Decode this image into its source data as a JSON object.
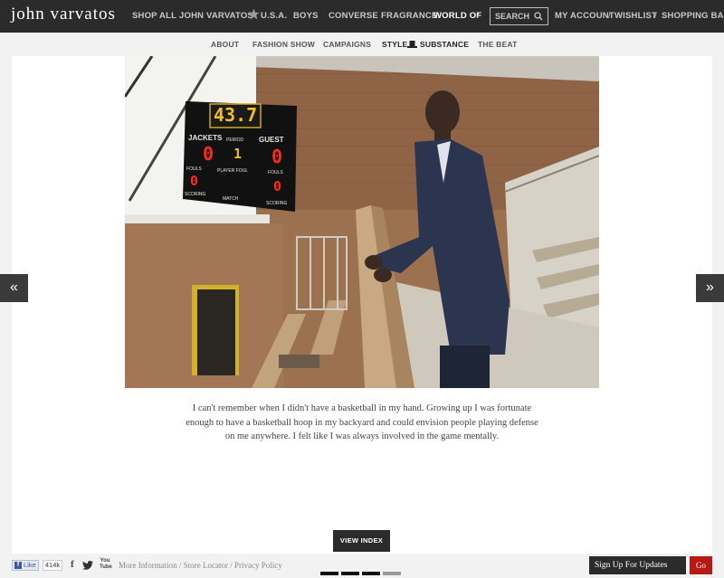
{
  "brand": {
    "logo": "john varvatos"
  },
  "topnav": {
    "shop_all": "SHOP ALL",
    "john_varvatos": "JOHN VARVATOS",
    "usa": "U.S.A.",
    "boys": "BOYS",
    "converse": "CONVERSE",
    "fragrance": "FRAGRANCE",
    "world_of": "WORLD OF",
    "slash": "/",
    "search_placeholder": "SEARCH",
    "my_account": "MY ACCOUNT",
    "wishlist": "WISHLIST",
    "shopping_bag": "SHOPPING BAG"
  },
  "subnav": {
    "about": "ABOUT",
    "fashion_show": "FASHION SHOW",
    "campaigns": "CAMPAIGNS",
    "style": "STYLE",
    "substance": "SUBSTANCE",
    "the_beat": "THE BEAT"
  },
  "photo": {
    "scoreboard": {
      "clock": "43.7",
      "home_label": "JACKETS",
      "period_label": "PERIOD",
      "guest_label": "GUEST",
      "home_score": "0",
      "period": "1",
      "guest_score": "0",
      "fouls_label": "FOULS",
      "player_foul_label": "PLAYER FOUL",
      "home_fouls": "0",
      "guest_fouls": "0",
      "scoring_label": "SCORING",
      "match_label": "MATCH"
    }
  },
  "quote": {
    "line1": "I can't remember when I didn't have a basketball in my hand. Growing up I was fortunate",
    "line2": "enough to have a basketball hoop in my backyard and could envision people playing defense",
    "line3": "on me anywhere. I felt like I was always involved in the game mentally."
  },
  "arrows": {
    "prev": "«",
    "next": "»"
  },
  "view_index": "VIEW INDEX",
  "footer": {
    "fb_like": "Like",
    "fb_count": "414k",
    "youtube": "You Tube",
    "more_information": "More Information",
    "store_locator": "Store Locator",
    "privacy_policy": "Privacy Policy",
    "sep": "/",
    "slides_total": 4,
    "slides_active": 3,
    "signup": "Sign Up For Updates",
    "go": "Go"
  },
  "colors": {
    "topbar": "#2b2b2b",
    "go_button": "#b81914",
    "scoreboard_digits": "#ff2a1a",
    "clock_digits": "#f3c020"
  }
}
